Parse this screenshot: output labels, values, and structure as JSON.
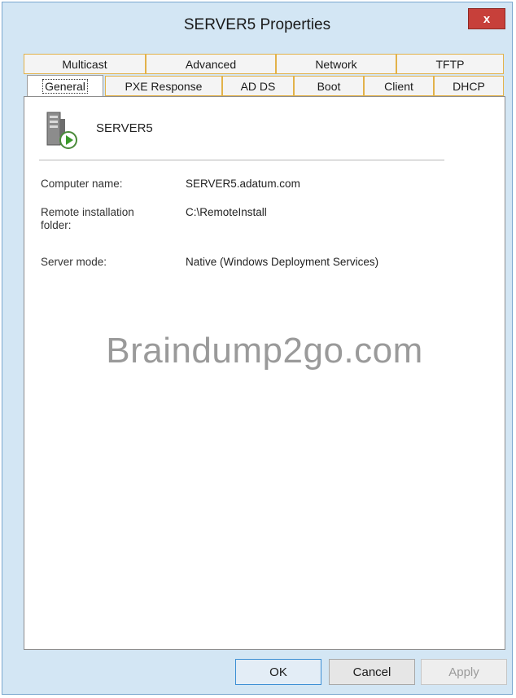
{
  "window": {
    "title": "SERVER5 Properties",
    "close_label": "x"
  },
  "tabs_row1": [
    "Multicast",
    "Advanced",
    "Network",
    "TFTP"
  ],
  "tabs_row2": [
    "General",
    "PXE Response",
    "AD DS",
    "Boot",
    "Client",
    "DHCP"
  ],
  "selected_tab": "General",
  "general": {
    "server_name": "SERVER5",
    "computer_name_label": "Computer name:",
    "computer_name_value": "SERVER5.adatum.com",
    "remote_folder_label_line1": "Remote installation",
    "remote_folder_label_line2": "folder:",
    "remote_folder_value": "C:\\RemoteInstall",
    "server_mode_label": "Server mode:",
    "server_mode_value": "Native (Windows Deployment Services)"
  },
  "watermark": "Braindump2go.com",
  "buttons": {
    "ok": "OK",
    "cancel": "Cancel",
    "apply": "Apply"
  },
  "icons": {
    "server": "server-icon",
    "close": "close-icon"
  },
  "colors": {
    "window_frame": "#d3e6f4",
    "tab_border_accent": "#e2b24a",
    "close_button": "#c7403a"
  }
}
